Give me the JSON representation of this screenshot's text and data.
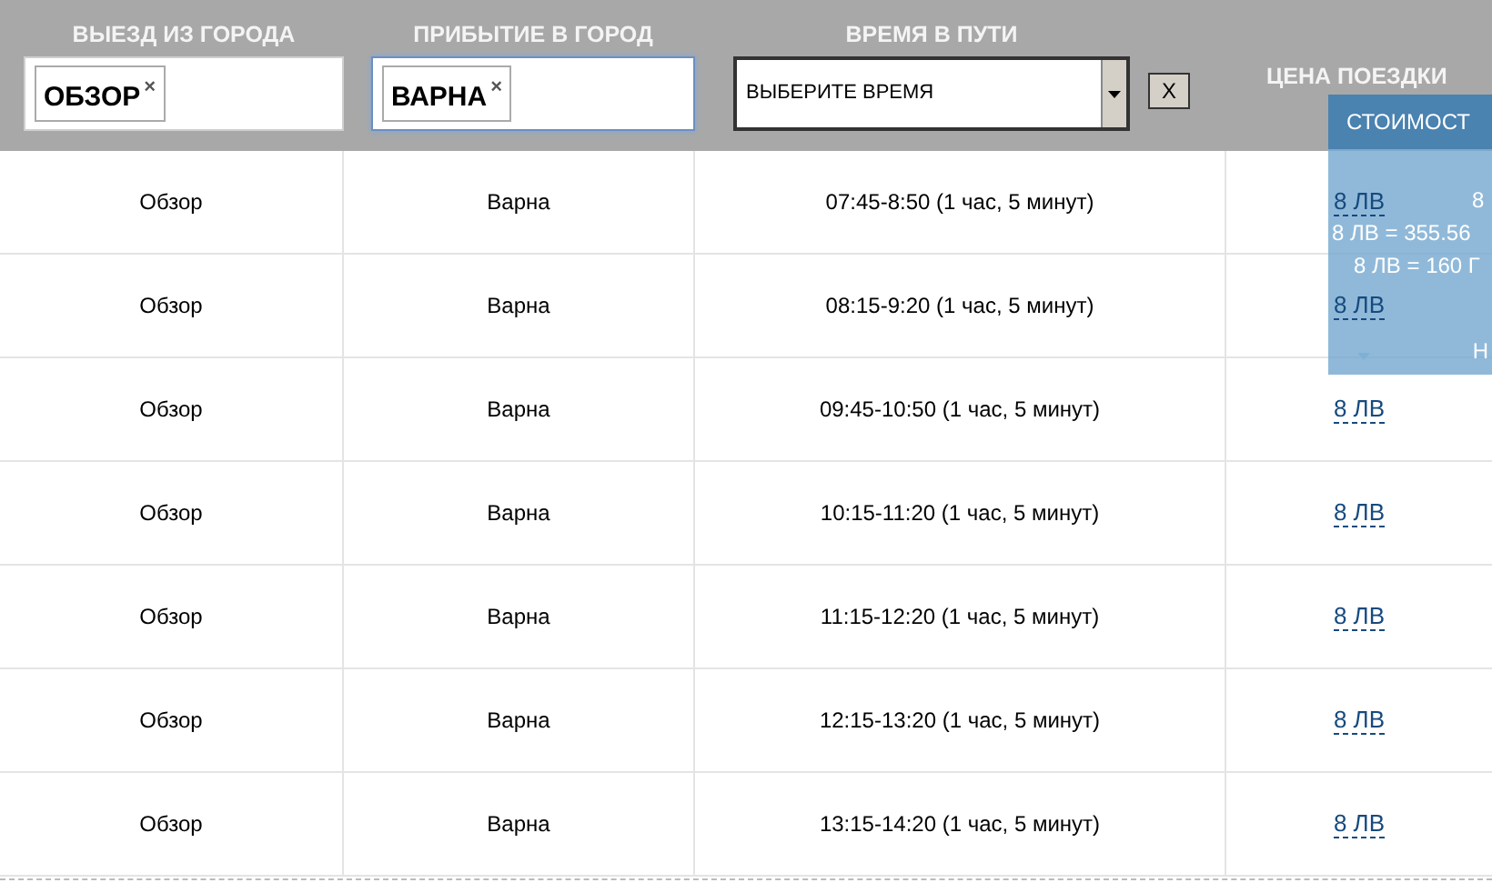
{
  "filters": [
    {
      "label": "ВЫЕЗД ИЗ ГОРОДА",
      "token": "ОБЗОР",
      "remove": "×",
      "focused": false
    },
    {
      "label": "ПРИБЫТИЕ В ГОРОД",
      "token": "ВАРНА",
      "remove": "×",
      "focused": true
    }
  ],
  "time_filter": {
    "label": "ВРЕМЯ В ПУТИ",
    "placeholder": "ВЫБЕРИТЕ ВРЕМЯ",
    "clear": "X"
  },
  "price_header": "ЦЕНА ПОЕЗДКИ",
  "rows": [
    {
      "from": "Обзор",
      "to": "Варна",
      "time": "07:45-8:50 (1 час, 5 минут)",
      "price": "8 ЛВ"
    },
    {
      "from": "Обзор",
      "to": "Варна",
      "time": "08:15-9:20 (1 час, 5 минут)",
      "price": "8 ЛВ"
    },
    {
      "from": "Обзор",
      "to": "Варна",
      "time": "09:45-10:50 (1 час, 5 минут)",
      "price": "8 ЛВ"
    },
    {
      "from": "Обзор",
      "to": "Варна",
      "time": "10:15-11:20 (1 час, 5 минут)",
      "price": "8 ЛВ"
    },
    {
      "from": "Обзор",
      "to": "Варна",
      "time": "11:15-12:20 (1 час, 5 минут)",
      "price": "8 ЛВ"
    },
    {
      "from": "Обзор",
      "to": "Варна",
      "time": "12:15-13:20 (1 час, 5 минут)",
      "price": "8 ЛВ"
    },
    {
      "from": "Обзор",
      "to": "Варна",
      "time": "13:15-14:20 (1 час, 5 минут)",
      "price": "8 ЛВ"
    }
  ],
  "tooltip": {
    "title": "СТОИМОСТ",
    "lines": [
      "8",
      "8 ЛВ = 355.56",
      "8 ЛВ = 160 Г"
    ],
    "footer": "Н"
  }
}
